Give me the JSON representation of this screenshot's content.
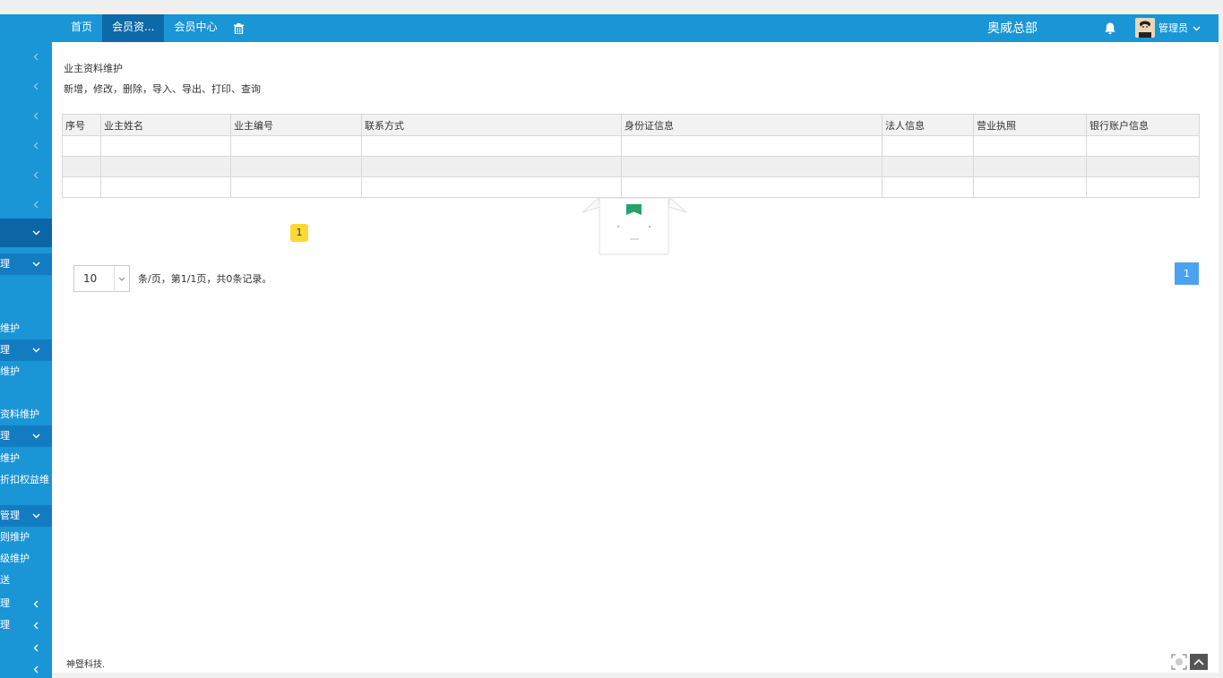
{
  "nav": {
    "tabs": [
      {
        "label": "首页"
      },
      {
        "label": "会员资..."
      },
      {
        "label": "会员中心"
      }
    ]
  },
  "header": {
    "org": "奥威总部",
    "user": "管理员"
  },
  "sidebar": {
    "items": [
      {
        "label": ""
      },
      {
        "label": "理"
      },
      {
        "label": "维护"
      },
      {
        "label": "理"
      },
      {
        "label": "维护"
      },
      {
        "label": "资料维护"
      },
      {
        "label": "理"
      },
      {
        "label": "维护"
      },
      {
        "label": "折扣权益维"
      },
      {
        "label": "管理"
      },
      {
        "label": "则维护"
      },
      {
        "label": "级维护"
      },
      {
        "label": "送"
      },
      {
        "label": "理"
      },
      {
        "label": "理"
      },
      {
        "label": ""
      },
      {
        "label": ""
      }
    ]
  },
  "page": {
    "title": "业主资料维护",
    "operations": "新增，修改，删除，导入、导出、打印、查询"
  },
  "table": {
    "headers": [
      "序号",
      "业主姓名",
      "业主编号",
      "联系方式",
      "身份证信息",
      "法人信息",
      "营业执照",
      "银行账户信息"
    ],
    "rows": [
      [
        "",
        "",
        "",
        "",
        "",
        "",
        "",
        ""
      ],
      [
        "",
        "",
        "",
        "",
        "",
        "",
        "",
        ""
      ],
      [
        "",
        "",
        "",
        "",
        "",
        "",
        "",
        ""
      ]
    ]
  },
  "badge": "1",
  "pager": {
    "page_size": "10",
    "info": "条/页，第1/1页，共0条记录。",
    "current": "1"
  },
  "footer": {
    "text": "神暨科技."
  },
  "colors": {
    "header_bg": "#1a95d6",
    "active_tab": "#0d6aa8",
    "page_button": "#4aa3f0",
    "badge": "#fdd835"
  }
}
